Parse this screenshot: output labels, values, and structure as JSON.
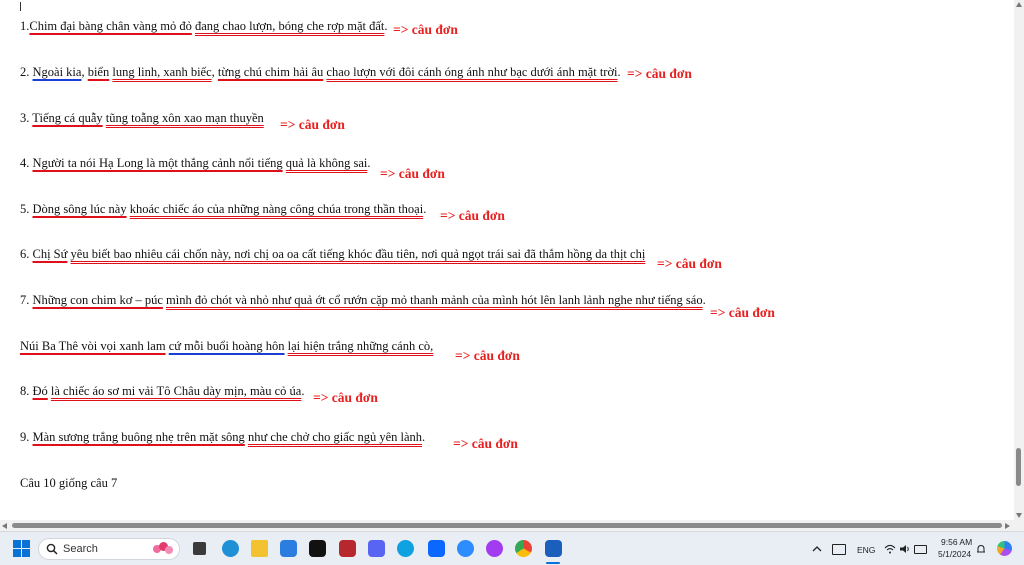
{
  "document": {
    "lines": [
      {
        "segments": [
          {
            "text": "1."
          },
          {
            "text": "Chim đại bàng chân vàng mỏ đỏ",
            "u": "r"
          },
          {
            "text": " "
          },
          {
            "text": "đang chao lượn, bóng che rợp mặt đất",
            "u": "2"
          },
          {
            "text": "."
          }
        ],
        "answer": "=> câu đơn"
      },
      {
        "segments": [
          {
            "text": "2. "
          },
          {
            "text": "Ngoài kia",
            "u": "b"
          },
          {
            "text": ", "
          },
          {
            "text": "biển",
            "u": "r"
          },
          {
            "text": " "
          },
          {
            "text": "lung linh, xanh biếc",
            "u": "2"
          },
          {
            "text": ", "
          },
          {
            "text": "từng chú chim hải âu",
            "u": "r"
          },
          {
            "text": " "
          },
          {
            "text": "chao lượn với đôi cánh óng ánh như bạc dưới ánh mặt trời",
            "u": "2"
          },
          {
            "text": "."
          }
        ],
        "answer": "=> câu đơn"
      },
      {
        "segments": [
          {
            "text": "3. "
          },
          {
            "text": "Tiếng cá quẫy",
            "u": "r"
          },
          {
            "text": " "
          },
          {
            "text": "tũng toẵng xôn xao mạn thuyền",
            "u": "2"
          }
        ],
        "answer": "=> câu đơn"
      },
      {
        "segments": [
          {
            "text": "4. "
          },
          {
            "text": "Người ta nói Hạ Long là một thắng cảnh nổi tiếng",
            "u": "r"
          },
          {
            "text": " "
          },
          {
            "text": "quả là không sai",
            "u": "2"
          },
          {
            "text": "."
          }
        ],
        "answer": "=> câu đơn"
      },
      {
        "segments": [
          {
            "text": "5. "
          },
          {
            "text": "Dòng sông lúc này",
            "u": "r"
          },
          {
            "text": " "
          },
          {
            "text": "khoác chiếc áo của những nàng công chúa trong thần thoại",
            "u": "2"
          },
          {
            "text": "."
          }
        ],
        "answer": "=> câu đơn"
      },
      {
        "segments": [
          {
            "text": "6. "
          },
          {
            "text": "Chị Sứ",
            "u": "r"
          },
          {
            "text": " "
          },
          {
            "text": "yêu biết bao nhiêu cái chốn này, nơi chị oa oa cất tiếng khóc đầu tiên, nơi quả ngọt trái sai đã thắm hồng da thịt chị",
            "u": "2"
          }
        ],
        "answer": "=> câu đơn"
      },
      {
        "segments": [
          {
            "text": "7. "
          },
          {
            "text": "Những con chim kơ – púc",
            "u": "r"
          },
          {
            "text": " "
          },
          {
            "text": "mình đỏ chót và nhỏ như quả ớt cổ rướn cặp mỏ thanh mảnh của mình hót lên lanh lảnh nghe như tiếng sáo",
            "u": "2"
          },
          {
            "text": "."
          }
        ],
        "answer": "=> câu đơn"
      },
      {
        "segments": [
          {
            "text": "Núi Ba Thê vòi vọi xanh lam",
            "u": "r"
          },
          {
            "text": " "
          },
          {
            "text": "cứ mỗi buổi hoàng hôn",
            "u": "b"
          },
          {
            "text": " "
          },
          {
            "text": "lại hiện trắng những cánh cò,",
            "u": "2"
          }
        ],
        "answer": "=> câu đơn"
      },
      {
        "segments": [
          {
            "text": "8. "
          },
          {
            "text": "Đó",
            "u": "r"
          },
          {
            "text": " "
          },
          {
            "text": "là chiếc áo sơ mi vải Tô Châu dày mịn, màu cỏ úa",
            "u": "2"
          },
          {
            "text": "."
          }
        ],
        "answer": "=> câu đơn"
      },
      {
        "segments": [
          {
            "text": "9. "
          },
          {
            "text": "Màn sương trắng buông nhẹ trên mặt sông",
            "u": "r"
          },
          {
            "text": " "
          },
          {
            "text": "như che chở cho giấc ngủ yên lành",
            "u": "2"
          },
          {
            "text": "."
          }
        ],
        "answer": "=> câu đơn"
      },
      {
        "segments": [
          {
            "text": "Câu 10 giống câu 7"
          }
        ],
        "answer": ""
      }
    ]
  },
  "taskbar": {
    "search_placeholder": "Search",
    "tray": {
      "language": "ENG",
      "time": "9:56 AM",
      "date": "5/1/2024"
    }
  },
  "colors": {
    "answer": "#e8201f",
    "underline_red": "#e0101a",
    "underline_blue": "#1a3fd6"
  }
}
